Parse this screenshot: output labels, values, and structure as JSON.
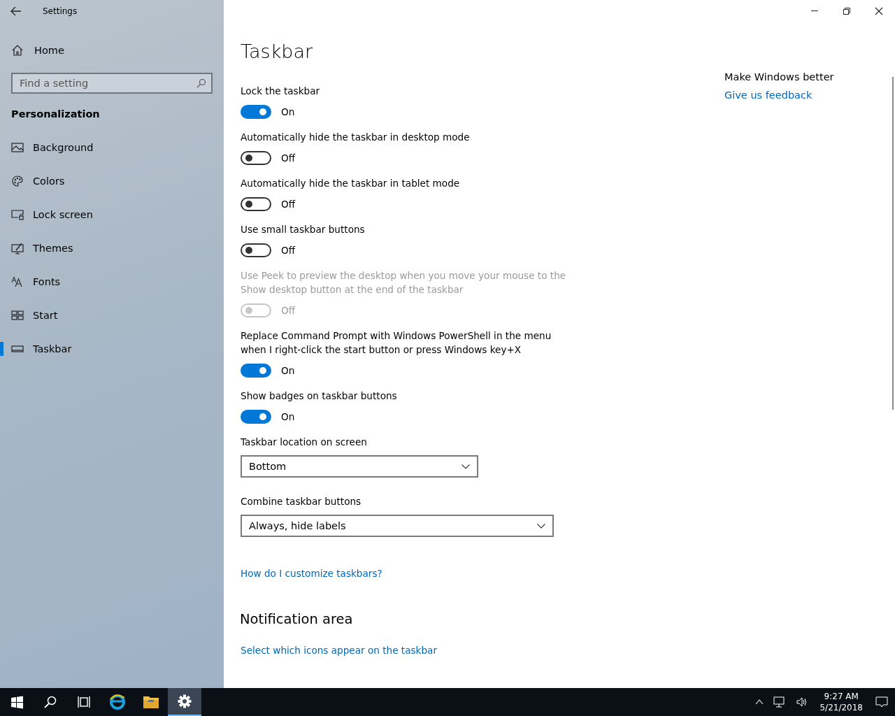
{
  "window": {
    "title": "Settings"
  },
  "sidebar": {
    "home": "Home",
    "search": {
      "placeholder": "Find a setting"
    },
    "section": "Personalization",
    "items": [
      {
        "label": "Background",
        "kind": "background",
        "selected": false
      },
      {
        "label": "Colors",
        "kind": "colors",
        "selected": false
      },
      {
        "label": "Lock screen",
        "kind": "lockscreen",
        "selected": false
      },
      {
        "label": "Themes",
        "kind": "themes",
        "selected": false
      },
      {
        "label": "Fonts",
        "kind": "fonts",
        "selected": false
      },
      {
        "label": "Start",
        "kind": "start",
        "selected": false
      },
      {
        "label": "Taskbar",
        "kind": "taskbar",
        "selected": true
      }
    ]
  },
  "page": {
    "title": "Taskbar",
    "settings": [
      {
        "kind": "toggle",
        "label": "Lock the taskbar",
        "on": true,
        "disabled": false,
        "state_text": "On"
      },
      {
        "kind": "toggle",
        "label": "Automatically hide the taskbar in desktop mode",
        "on": false,
        "disabled": false,
        "state_text": "Off"
      },
      {
        "kind": "toggle",
        "label": "Automatically hide the taskbar in tablet mode",
        "on": false,
        "disabled": false,
        "state_text": "Off"
      },
      {
        "kind": "toggle",
        "label": "Use small taskbar buttons",
        "on": false,
        "disabled": false,
        "state_text": "Off"
      },
      {
        "kind": "toggle",
        "label": "Use Peek to preview the desktop when you move your mouse to the Show desktop button at the end of the taskbar",
        "on": false,
        "disabled": true,
        "state_text": "Off"
      },
      {
        "kind": "toggle",
        "label": "Replace Command Prompt with Windows PowerShell in the menu when I right-click the start button or press Windows key+X",
        "on": true,
        "disabled": false,
        "state_text": "On"
      },
      {
        "kind": "toggle",
        "label": "Show badges on taskbar buttons",
        "on": true,
        "disabled": false,
        "state_text": "On"
      },
      {
        "kind": "dropdown",
        "label": "Taskbar location on screen",
        "value": "Bottom"
      },
      {
        "kind": "dropdown",
        "label": "Combine taskbar buttons",
        "value": "Always, hide labels"
      }
    ],
    "help_link": "How do I customize taskbars?",
    "sections": [
      {
        "title": "Notification area",
        "links": [
          "Select which icons appear on the taskbar"
        ]
      }
    ]
  },
  "aside": {
    "title": "Make Windows better",
    "link": "Give us feedback"
  },
  "taskbar": {
    "apps": [
      {
        "kind": "start",
        "active": false
      },
      {
        "kind": "search",
        "active": false
      },
      {
        "kind": "taskview",
        "active": false
      },
      {
        "kind": "edge",
        "active": false
      },
      {
        "kind": "explorer",
        "active": false
      },
      {
        "kind": "settings",
        "active": true
      }
    ],
    "clock": {
      "time": "9:27 AM",
      "date": "5/21/2018"
    }
  }
}
